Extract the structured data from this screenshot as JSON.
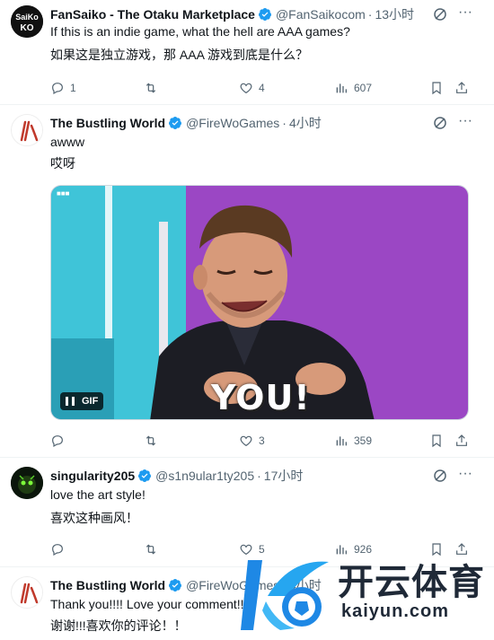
{
  "tweets": [
    {
      "name": "FanSaiko - The Otaku Marketplace",
      "handle": "@FanSaikocom",
      "time": "13小时",
      "text_en": "If this is an indie game, what the hell are AAA games?",
      "text_zh": "如果这是独立游戏，那 AAA 游戏到底是什么？",
      "reply_count": "1",
      "retweet_count": "",
      "like_count": "4",
      "view_count": "607",
      "avatar_text": "SaiKo"
    },
    {
      "name": "The Bustling World",
      "handle": "@FireWoGames",
      "time": "4小时",
      "text_en": "awww",
      "text_zh": "哎呀",
      "gif_label": "GIF",
      "gif_caption": "YOU!",
      "reply_count": "",
      "retweet_count": "",
      "like_count": "3",
      "view_count": "359"
    },
    {
      "name": "singularity205",
      "handle": "@s1n9ular1ty205",
      "time": "17小时",
      "text_en": "love the art style!",
      "text_zh": "喜欢这种画风！",
      "reply_count": "",
      "retweet_count": "",
      "like_count": "5",
      "view_count": "926"
    },
    {
      "name": "The Bustling World",
      "handle": "@FireWoGames",
      "time": "4小时",
      "text_en": "Thank you!!!! Love your comment!!",
      "text_zh": "谢谢!!!喜欢你的评论！！"
    }
  ],
  "separator": "·",
  "more_glyph": "···",
  "watermark": {
    "title": "开云体育",
    "url": "kaiyun.com"
  },
  "colors": {
    "verified": "#1d9bf0",
    "secondary_text": "#536471",
    "divider": "#eff3f4",
    "gif_purple": "#9b47c4",
    "gif_teal": "#3fc4d8"
  }
}
